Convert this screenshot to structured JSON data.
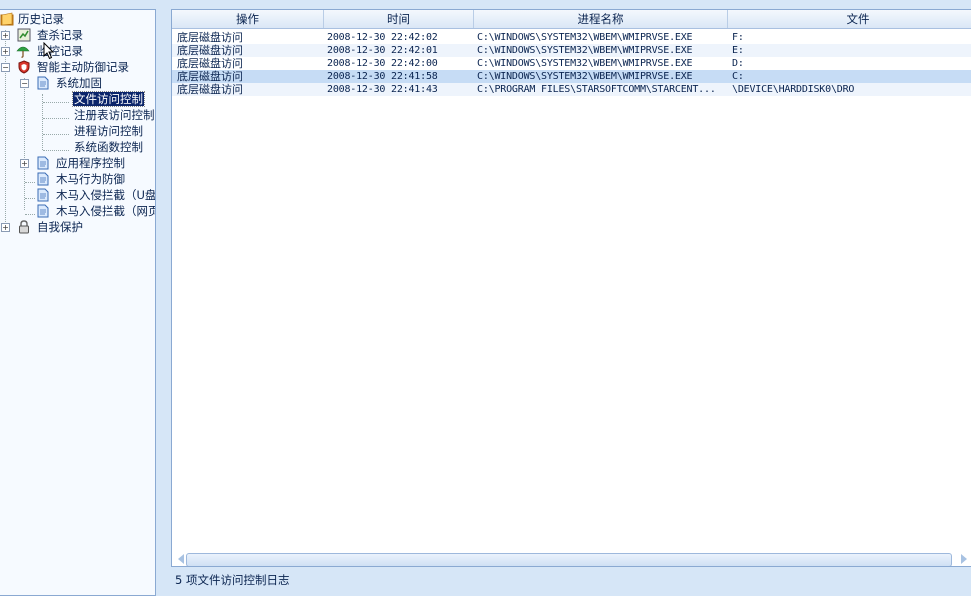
{
  "tree": {
    "root_label": "历史记录",
    "items": [
      {
        "label": "查杀记录"
      },
      {
        "label": "监控记录"
      },
      {
        "label": "智能主动防御记录"
      },
      {
        "label": "系统加固"
      },
      {
        "label": "文件访问控制"
      },
      {
        "label": "注册表访问控制"
      },
      {
        "label": "进程访问控制"
      },
      {
        "label": "系统函数控制"
      },
      {
        "label": "应用程序控制"
      },
      {
        "label": "木马行为防御"
      },
      {
        "label": "木马入侵拦截（U盘"
      },
      {
        "label": "木马入侵拦截（网页"
      },
      {
        "label": "自我保护"
      }
    ]
  },
  "table": {
    "columns": [
      "操作",
      "时间",
      "进程名称",
      "文件"
    ],
    "rows": [
      [
        "底层磁盘访问",
        "2008-12-30 22:42:02",
        "C:\\WINDOWS\\SYSTEM32\\WBEM\\WMIPRVSE.EXE",
        "F:"
      ],
      [
        "底层磁盘访问",
        "2008-12-30 22:42:01",
        "C:\\WINDOWS\\SYSTEM32\\WBEM\\WMIPRVSE.EXE",
        "E:"
      ],
      [
        "底层磁盘访问",
        "2008-12-30 22:42:00",
        "C:\\WINDOWS\\SYSTEM32\\WBEM\\WMIPRVSE.EXE",
        "D:"
      ],
      [
        "底层磁盘访问",
        "2008-12-30 22:41:58",
        "C:\\WINDOWS\\SYSTEM32\\WBEM\\WMIPRVSE.EXE",
        "C:"
      ],
      [
        "底层磁盘访问",
        "2008-12-30 22:41:43",
        "C:\\PROGRAM FILES\\STARSOFTCOMM\\STARCENT...",
        "\\DEVICE\\HARDDISK0\\DRO"
      ]
    ],
    "selected_row_index": 3
  },
  "status": {
    "text": "5 项文件访问控制日志"
  },
  "colors": {
    "selection": "#0a246a",
    "row_highlight": "#c6dcf5",
    "accent": "#8aa9d2"
  }
}
